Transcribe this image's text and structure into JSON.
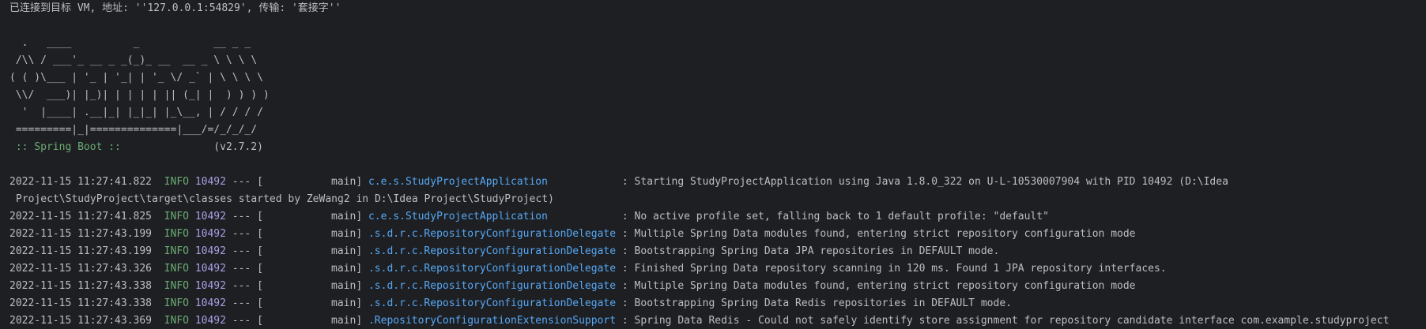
{
  "connection": {
    "message": "已连接到目标 VM, 地址: ''127.0.0.1:54829', 传输: '套接字''"
  },
  "banner": {
    "art": [
      "  .   ____          _            __ _ _",
      " /\\\\ / ___'_ __ _ _(_)_ __  __ _ \\ \\ \\ \\",
      "( ( )\\___ | '_ | '_| | '_ \\/ _` | \\ \\ \\ \\",
      " \\\\/  ___)| |_)| | | | | || (_| |  ) ) ) )",
      "  '  |____| .__|_| |_|_| |_\\__, | / / / /",
      " =========|_|==============|___/=/_/_/_/"
    ],
    "spring_label": " :: Spring Boot ::",
    "version": "(v2.7.2)"
  },
  "log": {
    "entries": [
      {
        "timestamp": "2022-11-15 11:27:41.822",
        "level": "INFO",
        "pid": "10492",
        "sep": "--- [",
        "thread": "main]",
        "logger": "c.e.s.StudyProjectApplication",
        "logger_pad": "            ",
        "message": ": Starting StudyProjectApplication using Java 1.8.0_322 on U-L-10530007904 with PID 10492 (D:\\Idea",
        "continuation": "Project\\StudyProject\\target\\classes started by ZeWang2 in D:\\Idea Project\\StudyProject)"
      },
      {
        "timestamp": "2022-11-15 11:27:41.825",
        "level": "INFO",
        "pid": "10492",
        "sep": "--- [",
        "thread": "main]",
        "logger": "c.e.s.StudyProjectApplication",
        "logger_pad": "            ",
        "message": ": No active profile set, falling back to 1 default profile: \"default\""
      },
      {
        "timestamp": "2022-11-15 11:27:43.199",
        "level": "INFO",
        "pid": "10492",
        "sep": "--- [",
        "thread": "main]",
        "logger": ".s.d.r.c.RepositoryConfigurationDelegate",
        "logger_pad": " ",
        "message": ": Multiple Spring Data modules found, entering strict repository configuration mode"
      },
      {
        "timestamp": "2022-11-15 11:27:43.199",
        "level": "INFO",
        "pid": "10492",
        "sep": "--- [",
        "thread": "main]",
        "logger": ".s.d.r.c.RepositoryConfigurationDelegate",
        "logger_pad": " ",
        "message": ": Bootstrapping Spring Data JPA repositories in DEFAULT mode."
      },
      {
        "timestamp": "2022-11-15 11:27:43.326",
        "level": "INFO",
        "pid": "10492",
        "sep": "--- [",
        "thread": "main]",
        "logger": ".s.d.r.c.RepositoryConfigurationDelegate",
        "logger_pad": " ",
        "message": ": Finished Spring Data repository scanning in 120 ms. Found 1 JPA repository interfaces."
      },
      {
        "timestamp": "2022-11-15 11:27:43.338",
        "level": "INFO",
        "pid": "10492",
        "sep": "--- [",
        "thread": "main]",
        "logger": ".s.d.r.c.RepositoryConfigurationDelegate",
        "logger_pad": " ",
        "message": ": Multiple Spring Data modules found, entering strict repository configuration mode"
      },
      {
        "timestamp": "2022-11-15 11:27:43.338",
        "level": "INFO",
        "pid": "10492",
        "sep": "--- [",
        "thread": "main]",
        "logger": ".s.d.r.c.RepositoryConfigurationDelegate",
        "logger_pad": " ",
        "message": ": Bootstrapping Spring Data Redis repositories in DEFAULT mode."
      },
      {
        "timestamp": "2022-11-15 11:27:43.369",
        "level": "INFO",
        "pid": "10492",
        "sep": "--- [",
        "thread": "main]",
        "logger": ".RepositoryConfigurationExtensionSupport",
        "logger_pad": " ",
        "message": ": Spring Data Redis - Could not safely identify store assignment for repository candidate interface com.example.studyproject"
      }
    ]
  }
}
